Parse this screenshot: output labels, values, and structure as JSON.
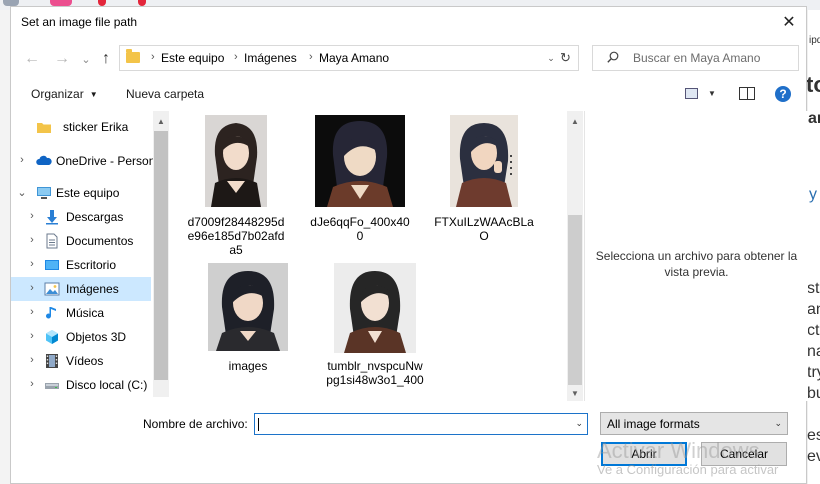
{
  "dialog": {
    "title": "Set an image file path",
    "close_glyph": "✕"
  },
  "background": {
    "right_chars": [
      "ipd",
      "to",
      "ar",
      "y",
      "sto",
      "and",
      "cti",
      "na",
      "try",
      "bu",
      "es,",
      "ev"
    ]
  },
  "nav_buttons": {
    "back_glyph": "←",
    "forward_glyph": "→",
    "recent_glyph": "⌄",
    "up_glyph": "↑"
  },
  "address": {
    "crumbs": [
      "Este equipo",
      "Imágenes",
      "Maya Amano"
    ],
    "separator": "›",
    "dropdown_glyph": "⌄",
    "refresh_glyph": "↻"
  },
  "search": {
    "placeholder": "Buscar en Maya Amano"
  },
  "toolbar": {
    "organize_label": "Organizar",
    "organize_caret": "▼",
    "new_folder_label": "Nueva carpeta",
    "view_caret": "▼",
    "help_glyph": "?"
  },
  "nav_pane": {
    "items": [
      {
        "label": "sticker Erika",
        "icon": "folder-icon",
        "chevron": ""
      },
      {
        "label": "OneDrive - Person",
        "icon": "cloud-icon",
        "chevron": "›"
      },
      {
        "label": "Este equipo",
        "icon": "computer-icon",
        "chevron": "⌄"
      },
      {
        "label": "Descargas",
        "icon": "download-icon",
        "chevron": "›"
      },
      {
        "label": "Documentos",
        "icon": "document-icon",
        "chevron": "›"
      },
      {
        "label": "Escritorio",
        "icon": "desktop-icon",
        "chevron": "›"
      },
      {
        "label": "Imágenes",
        "icon": "pictures-icon",
        "chevron": "›",
        "selected": true
      },
      {
        "label": "Música",
        "icon": "music-icon",
        "chevron": "›"
      },
      {
        "label": "Objetos 3D",
        "icon": "cube-icon",
        "chevron": "›"
      },
      {
        "label": "Vídeos",
        "icon": "video-icon",
        "chevron": "›"
      },
      {
        "label": "Disco local (C:)",
        "icon": "drive-icon",
        "chevron": "›"
      }
    ]
  },
  "files": [
    {
      "name": "d7009f28448295de96e185d7b02afda5"
    },
    {
      "name": "dJe6qqFo_400x400"
    },
    {
      "name": "FTXuILzWAAcBLaO"
    },
    {
      "name": "images"
    },
    {
      "name": "tumblr_nvspcuNwpg1si48w3o1_400"
    }
  ],
  "preview": {
    "message": "Selecciona un archivo para obtener la vista previa."
  },
  "footer": {
    "filename_label": "Nombre de archivo:",
    "filename_value": "",
    "filename_caret": "⌄",
    "filter_value": "All image formats",
    "filter_caret": "⌄",
    "open_label": "Abrir",
    "cancel_label": "Cancelar"
  },
  "watermark": {
    "line1": "Activar Windows",
    "line2": "Ve a Configuración para activar"
  },
  "scrollbar": {
    "up_glyph": "▲",
    "down_glyph": "▼"
  },
  "colors": {
    "selection": "#cce8ff",
    "accent": "#0078d7",
    "folder": "#f3c449"
  }
}
